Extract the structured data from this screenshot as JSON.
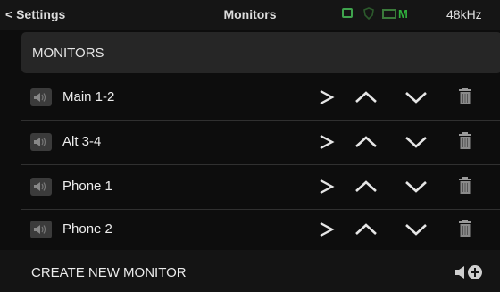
{
  "topbar": {
    "back_label": "< Settings",
    "title": "Monitors",
    "status_m": "M",
    "sample_rate": "48kHz"
  },
  "section": {
    "header": "MONITORS"
  },
  "monitors": [
    {
      "label": "Main 1-2"
    },
    {
      "label": "Alt 3-4"
    },
    {
      "label": "Phone 1"
    },
    {
      "label": "Phone 2"
    }
  ],
  "footer": {
    "create_label": "CREATE NEW MONITOR"
  },
  "colors": {
    "background": "#0d0d0d",
    "row_bg": "#262626",
    "status_green": "#2fae3c"
  }
}
